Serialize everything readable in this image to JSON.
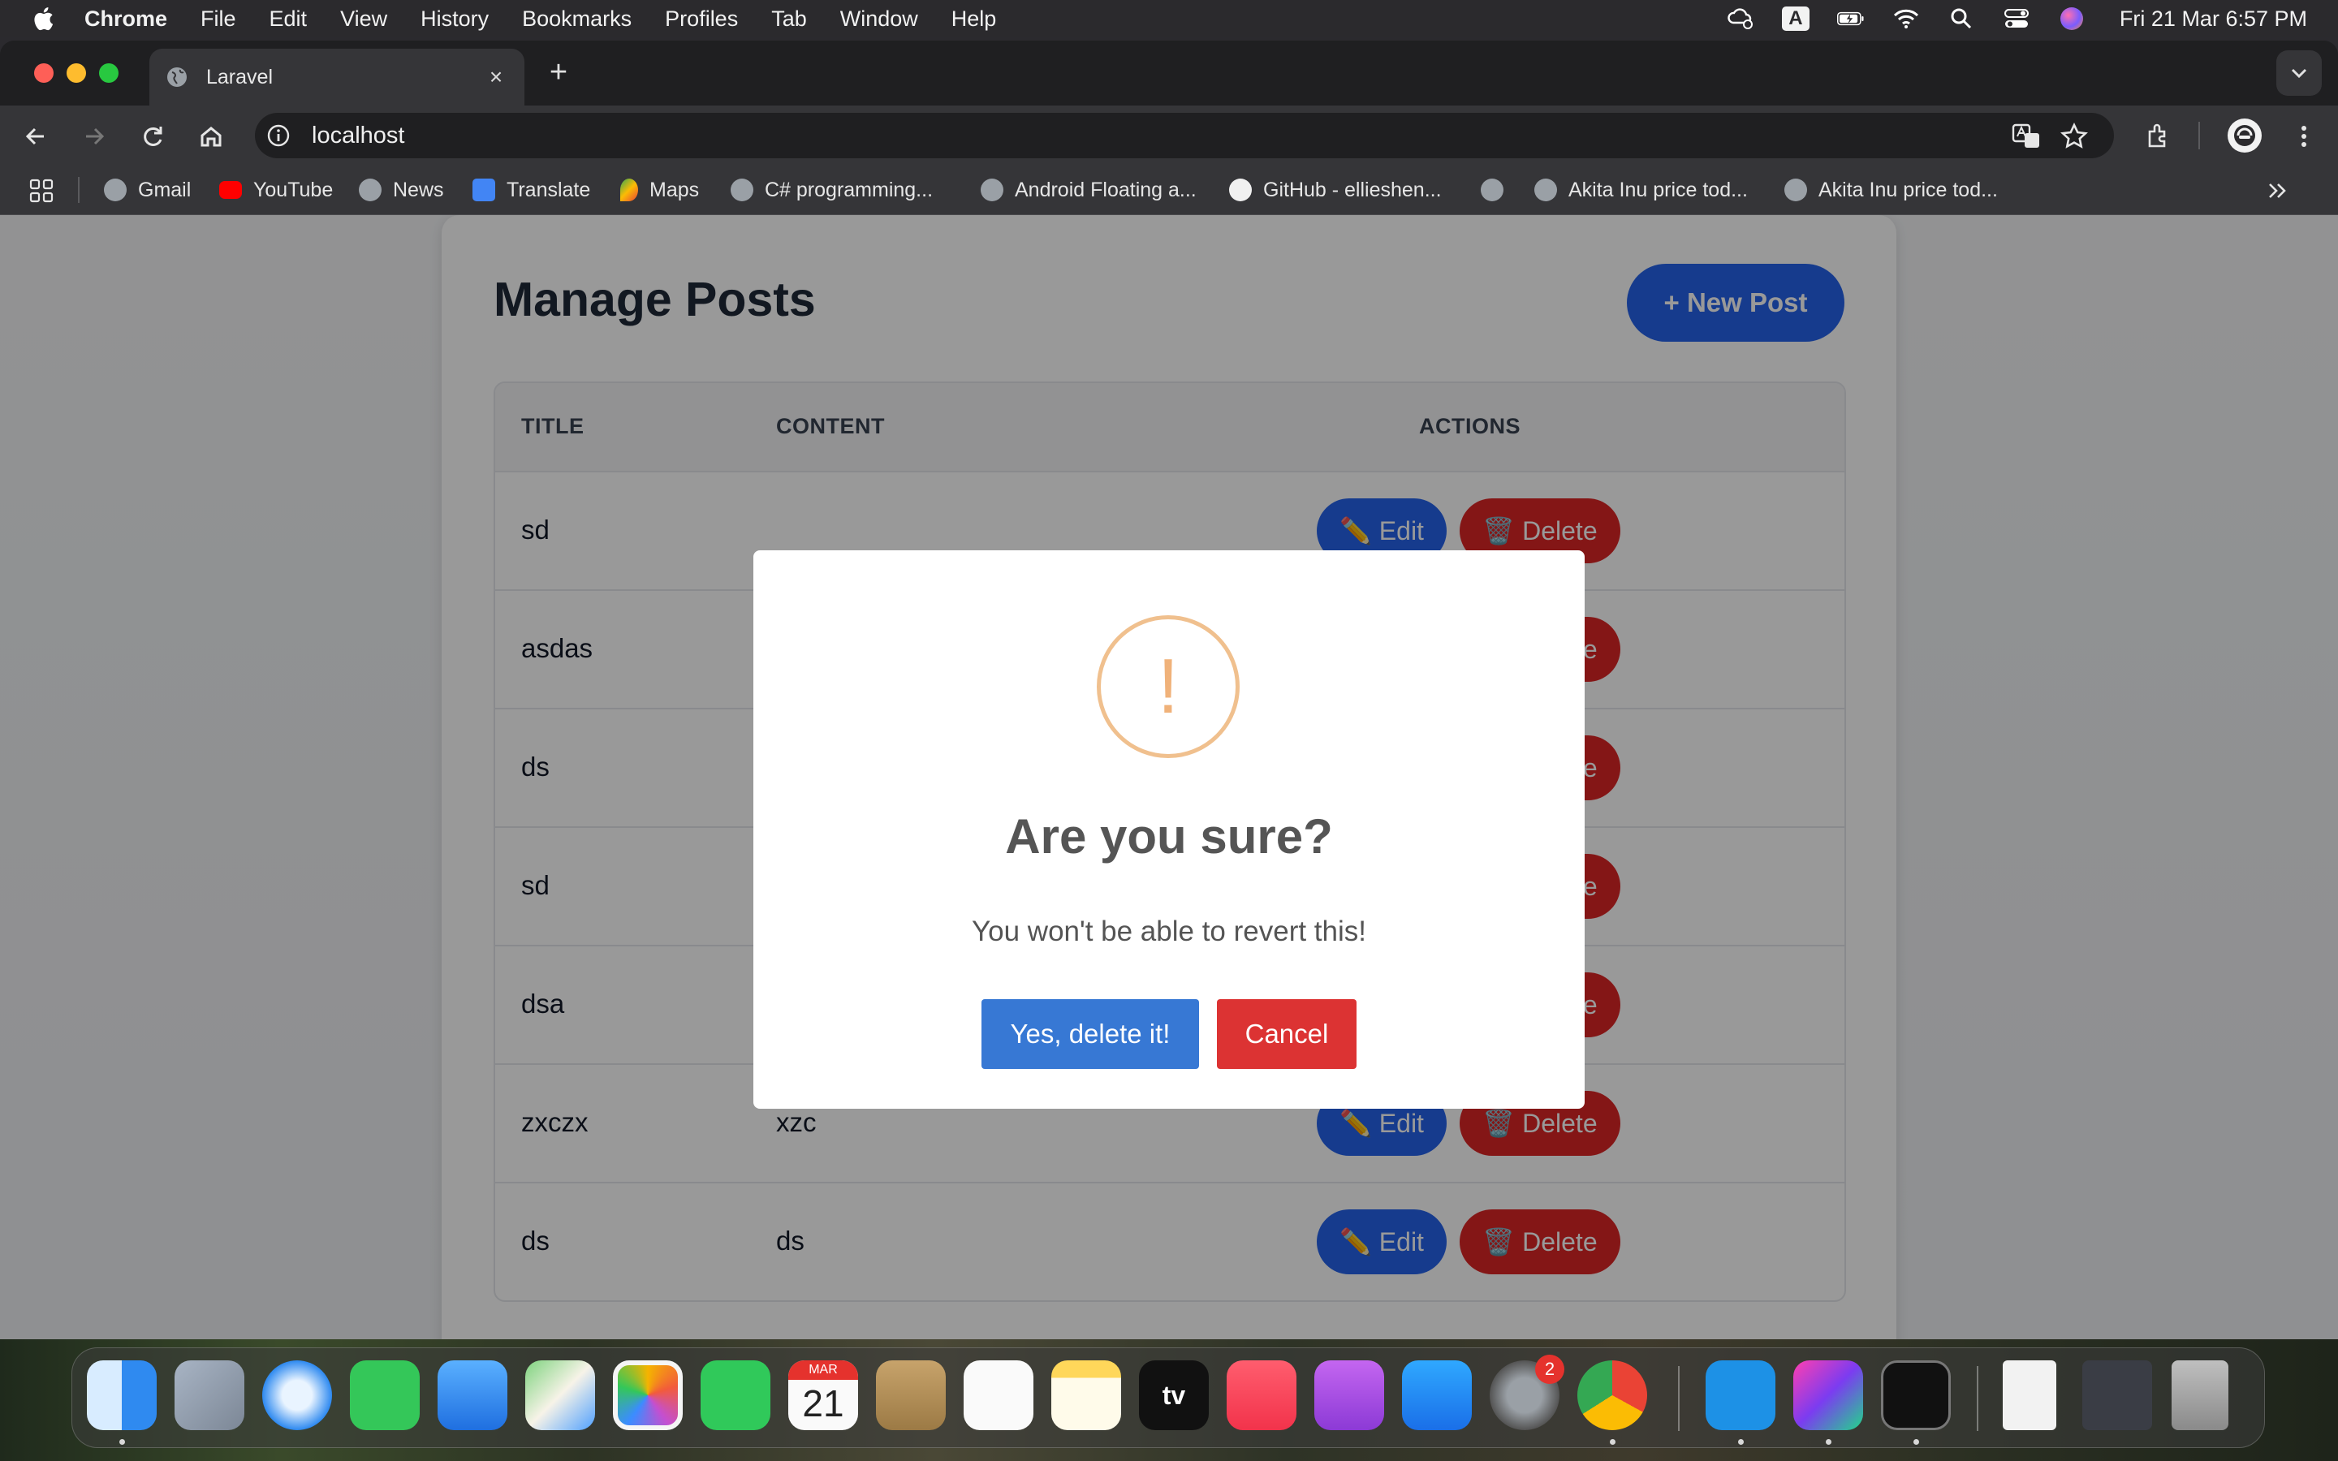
{
  "menubar": {
    "app_name": "Chrome",
    "menus": [
      "File",
      "Edit",
      "View",
      "History",
      "Bookmarks",
      "Profiles",
      "Tab",
      "Window",
      "Help"
    ],
    "input_source": "A",
    "clock": "Fri 21 Mar  6:57 PM"
  },
  "browser": {
    "tab_title": "Laravel",
    "tab_close": "×",
    "new_tab": "+",
    "url": "localhost",
    "bookmarks": [
      {
        "label": "Gmail",
        "icon": "globe-icon"
      },
      {
        "label": "YouTube",
        "icon": "youtube-icon"
      },
      {
        "label": "News",
        "icon": "globe-icon"
      },
      {
        "label": "Translate",
        "icon": "translate-icon"
      },
      {
        "label": "Maps",
        "icon": "maps-icon"
      },
      {
        "label": "C# programming...",
        "icon": "globe-icon"
      },
      {
        "label": "Android Floating a...",
        "icon": "globe-icon"
      },
      {
        "label": "GitHub - ellieshen...",
        "icon": "github-icon"
      },
      {
        "label": "",
        "icon": "globe-icon"
      },
      {
        "label": "Akita Inu price tod...",
        "icon": "globe-icon"
      },
      {
        "label": "Akita Inu price tod...",
        "icon": "globe-icon"
      }
    ]
  },
  "page": {
    "title": "Manage Posts",
    "new_post_label": "+ New Post",
    "columns": [
      "TITLE",
      "CONTENT",
      "ACTIONS"
    ],
    "edit_label": "✏️ Edit",
    "delete_label": "🗑️ Delete",
    "rows": [
      {
        "title": "sd",
        "content": ""
      },
      {
        "title": "asdas",
        "content": ""
      },
      {
        "title": "ds",
        "content": ""
      },
      {
        "title": "sd",
        "content": ""
      },
      {
        "title": "dsa",
        "content": ""
      },
      {
        "title": "zxczx",
        "content": "xzc"
      },
      {
        "title": "ds",
        "content": "ds"
      }
    ]
  },
  "modal": {
    "icon": "!",
    "title": "Are you sure?",
    "text": "You won't be able to revert this!",
    "confirm_label": "Yes, delete it!",
    "cancel_label": "Cancel"
  },
  "dock": {
    "calendar_month": "MAR",
    "calendar_day": "21",
    "settings_badge": "2",
    "tv_label": "tv"
  },
  "colors": {
    "primary": "#2563eb",
    "danger": "#dc2626",
    "modal_confirm": "#3778d4",
    "modal_cancel": "#dc3333",
    "warning_ring": "#f0c08e"
  }
}
